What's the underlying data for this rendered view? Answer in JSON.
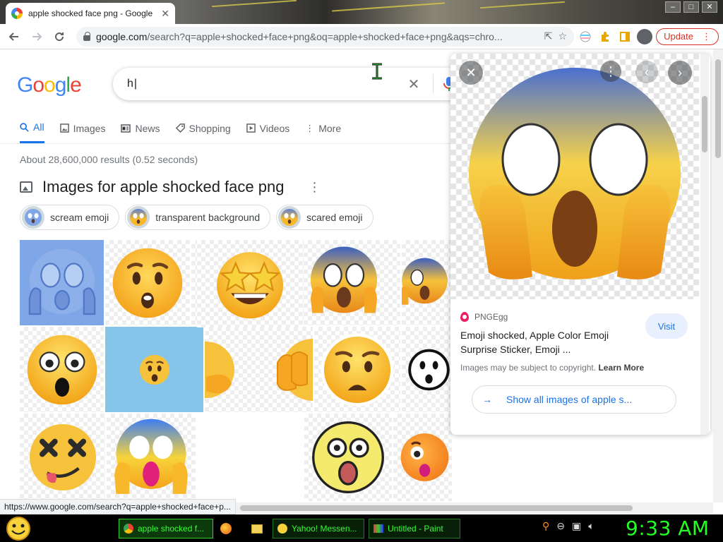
{
  "browser": {
    "tab_title": "apple shocked face png - Google Search",
    "url_host": "google.com",
    "url_rest": "/search?q=apple+shocked+face+png&oq=apple+shocked+face+png&aqs=chro...",
    "update_label": "Update",
    "win_min": "–",
    "win_max": "□",
    "win_close": "✕"
  },
  "search": {
    "logo": [
      "G",
      "o",
      "o",
      "g",
      "l",
      "e"
    ],
    "query": "h",
    "clear_symbol": "✕"
  },
  "tabs": [
    {
      "label": "All",
      "icon": "search-icon"
    },
    {
      "label": "Images",
      "icon": "image-icon"
    },
    {
      "label": "News",
      "icon": "news-icon"
    },
    {
      "label": "Shopping",
      "icon": "tag-icon"
    },
    {
      "label": "Videos",
      "icon": "play-icon"
    },
    {
      "label": "More",
      "icon": "more-vert-icon"
    }
  ],
  "results": {
    "stats": "About 28,600,000 results (0.52 seconds)",
    "images_heading": "Images for apple shocked face png"
  },
  "chips": [
    {
      "label": "scream emoji"
    },
    {
      "label": "transparent background"
    },
    {
      "label": "scared emoji"
    }
  ],
  "panel": {
    "source": "PNGEgg",
    "title": "Emoji shocked, Apple Color Emoji Surprise Sticker, Emoji ...",
    "visit": "Visit",
    "copyright": "Images may be subject to copyright.",
    "learn_more": "Learn More",
    "show_all": "Show all images of apple s..."
  },
  "status_url": "https://www.google.com/search?q=apple+shocked+face+p...",
  "taskbar": {
    "items": [
      {
        "label": "apple shocked f...",
        "icon": "chrome-icon"
      },
      {
        "label": "",
        "icon": "firefox-icon"
      },
      {
        "label": "",
        "icon": "folder-icon"
      },
      {
        "label": "Yahoo! Messen...",
        "icon": "yahoo-messenger-icon"
      },
      {
        "label": "Untitled - Paint",
        "icon": "paint-icon"
      }
    ],
    "clock": "9:33 AM"
  },
  "colors": {
    "accent": "#1a73e8",
    "clock": "#22ff22",
    "emoji_yellow": "#f7b92b",
    "emoji_blue": "#5a7fd6"
  }
}
